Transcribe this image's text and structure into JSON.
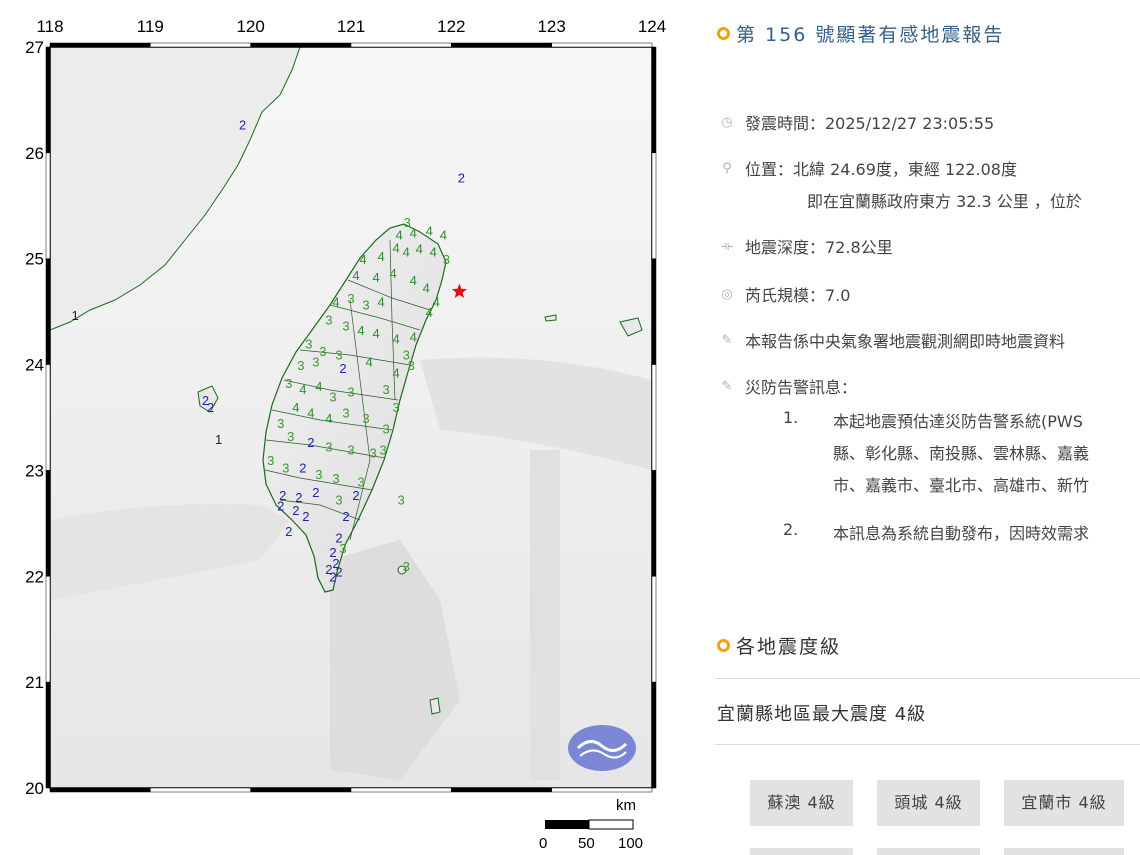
{
  "map": {
    "lon_ticks": [
      "118",
      "119",
      "120",
      "121",
      "122",
      "123",
      "124"
    ],
    "lat_ticks": [
      "27",
      "26",
      "25",
      "24",
      "23",
      "22",
      "21",
      "20"
    ],
    "epicenter_lon": 122.08,
    "epicenter_lat": 24.69,
    "scale": {
      "unit": "km",
      "labels": [
        "0",
        "50",
        "100"
      ]
    },
    "intensity_colors": {
      "4": "#2e8b2e",
      "3": "#3a9a2a",
      "2": "#2222aa",
      "1": "#222222"
    },
    "intensity_labels": [
      {
        "v": "2",
        "lon": 119.92,
        "lat": 26.22
      },
      {
        "v": "2",
        "lon": 122.1,
        "lat": 25.72
      },
      {
        "v": "1",
        "lon": 118.25,
        "lat": 24.42
      },
      {
        "v": "3",
        "lon": 121.56,
        "lat": 25.3
      },
      {
        "v": "4",
        "lon": 121.48,
        "lat": 25.18
      },
      {
        "v": "4",
        "lon": 121.62,
        "lat": 25.2
      },
      {
        "v": "4",
        "lon": 121.78,
        "lat": 25.22
      },
      {
        "v": "4",
        "lon": 121.92,
        "lat": 25.18
      },
      {
        "v": "4",
        "lon": 121.45,
        "lat": 25.06
      },
      {
        "v": "4",
        "lon": 121.55,
        "lat": 25.02
      },
      {
        "v": "4",
        "lon": 121.68,
        "lat": 25.05
      },
      {
        "v": "4",
        "lon": 121.82,
        "lat": 25.02
      },
      {
        "v": "3",
        "lon": 121.95,
        "lat": 24.95
      },
      {
        "v": "4",
        "lon": 121.3,
        "lat": 24.98
      },
      {
        "v": "4",
        "lon": 121.12,
        "lat": 24.95
      },
      {
        "v": "4",
        "lon": 121.05,
        "lat": 24.8
      },
      {
        "v": "4",
        "lon": 121.25,
        "lat": 24.78
      },
      {
        "v": "4",
        "lon": 121.42,
        "lat": 24.82
      },
      {
        "v": "4",
        "lon": 121.62,
        "lat": 24.75
      },
      {
        "v": "4",
        "lon": 121.75,
        "lat": 24.68
      },
      {
        "v": "4",
        "lon": 121.85,
        "lat": 24.55
      },
      {
        "v": "4",
        "lon": 121.78,
        "lat": 24.45
      },
      {
        "v": "3",
        "lon": 121.0,
        "lat": 24.58
      },
      {
        "v": "4",
        "lon": 120.85,
        "lat": 24.55
      },
      {
        "v": "3",
        "lon": 121.15,
        "lat": 24.52
      },
      {
        "v": "4",
        "lon": 121.3,
        "lat": 24.55
      },
      {
        "v": "3",
        "lon": 120.78,
        "lat": 24.38
      },
      {
        "v": "3",
        "lon": 120.95,
        "lat": 24.32
      },
      {
        "v": "4",
        "lon": 121.1,
        "lat": 24.28
      },
      {
        "v": "4",
        "lon": 121.25,
        "lat": 24.25
      },
      {
        "v": "4",
        "lon": 121.45,
        "lat": 24.2
      },
      {
        "v": "4",
        "lon": 121.62,
        "lat": 24.22
      },
      {
        "v": "3",
        "lon": 121.55,
        "lat": 24.05
      },
      {
        "v": "3",
        "lon": 120.58,
        "lat": 24.15
      },
      {
        "v": "3",
        "lon": 120.72,
        "lat": 24.08
      },
      {
        "v": "3",
        "lon": 120.88,
        "lat": 24.05
      },
      {
        "v": "3",
        "lon": 120.65,
        "lat": 23.98
      },
      {
        "v": "3",
        "lon": 120.5,
        "lat": 23.95
      },
      {
        "v": "2",
        "lon": 120.92,
        "lat": 23.92
      },
      {
        "v": "4",
        "lon": 121.18,
        "lat": 23.98
      },
      {
        "v": "4",
        "lon": 121.45,
        "lat": 23.88
      },
      {
        "v": "3",
        "lon": 121.6,
        "lat": 23.95
      },
      {
        "v": "3",
        "lon": 120.38,
        "lat": 23.78
      },
      {
        "v": "4",
        "lon": 120.52,
        "lat": 23.72
      },
      {
        "v": "4",
        "lon": 120.68,
        "lat": 23.75
      },
      {
        "v": "3",
        "lon": 120.82,
        "lat": 23.65
      },
      {
        "v": "3",
        "lon": 121.0,
        "lat": 23.7
      },
      {
        "v": "3",
        "lon": 121.35,
        "lat": 23.72
      },
      {
        "v": "3",
        "lon": 121.45,
        "lat": 23.55
      },
      {
        "v": "4",
        "lon": 120.45,
        "lat": 23.55
      },
      {
        "v": "4",
        "lon": 120.6,
        "lat": 23.5
      },
      {
        "v": "4",
        "lon": 120.78,
        "lat": 23.45
      },
      {
        "v": "3",
        "lon": 120.95,
        "lat": 23.5
      },
      {
        "v": "3",
        "lon": 121.15,
        "lat": 23.45
      },
      {
        "v": "3",
        "lon": 121.35,
        "lat": 23.35
      },
      {
        "v": "3",
        "lon": 120.3,
        "lat": 23.4
      },
      {
        "v": "3",
        "lon": 120.4,
        "lat": 23.28
      },
      {
        "v": "2",
        "lon": 120.6,
        "lat": 23.22
      },
      {
        "v": "3",
        "lon": 120.78,
        "lat": 23.18
      },
      {
        "v": "3",
        "lon": 121.0,
        "lat": 23.15
      },
      {
        "v": "3",
        "lon": 121.22,
        "lat": 23.12
      },
      {
        "v": "3",
        "lon": 121.32,
        "lat": 23.15
      },
      {
        "v": "3",
        "lon": 120.2,
        "lat": 23.05
      },
      {
        "v": "3",
        "lon": 120.35,
        "lat": 22.98
      },
      {
        "v": "2",
        "lon": 120.52,
        "lat": 22.98
      },
      {
        "v": "3",
        "lon": 120.68,
        "lat": 22.92
      },
      {
        "v": "3",
        "lon": 120.85,
        "lat": 22.88
      },
      {
        "v": "3",
        "lon": 121.1,
        "lat": 22.85
      },
      {
        "v": "2",
        "lon": 121.05,
        "lat": 22.72
      },
      {
        "v": "2",
        "lon": 120.32,
        "lat": 22.72
      },
      {
        "v": "2",
        "lon": 120.48,
        "lat": 22.7
      },
      {
        "v": "2",
        "lon": 120.65,
        "lat": 22.75
      },
      {
        "v": "3",
        "lon": 120.88,
        "lat": 22.68
      },
      {
        "v": "2",
        "lon": 120.3,
        "lat": 22.62
      },
      {
        "v": "2",
        "lon": 120.45,
        "lat": 22.58
      },
      {
        "v": "2",
        "lon": 120.55,
        "lat": 22.52
      },
      {
        "v": "2",
        "lon": 120.38,
        "lat": 22.38
      },
      {
        "v": "2",
        "lon": 120.95,
        "lat": 22.52
      },
      {
        "v": "2",
        "lon": 120.88,
        "lat": 22.32
      },
      {
        "v": "2",
        "lon": 120.82,
        "lat": 22.18
      },
      {
        "v": "3",
        "lon": 120.92,
        "lat": 22.22
      },
      {
        "v": "2",
        "lon": 120.85,
        "lat": 22.08
      },
      {
        "v": "2",
        "lon": 120.78,
        "lat": 22.02
      },
      {
        "v": "2",
        "lon": 120.88,
        "lat": 22.0
      },
      {
        "v": "2",
        "lon": 120.82,
        "lat": 21.95
      },
      {
        "v": "3",
        "lon": 121.5,
        "lat": 22.68
      },
      {
        "v": "3",
        "lon": 121.55,
        "lat": 22.05
      },
      {
        "v": "2",
        "lon": 119.55,
        "lat": 23.62
      },
      {
        "v": "2",
        "lon": 119.6,
        "lat": 23.55
      },
      {
        "v": "1",
        "lon": 119.68,
        "lat": 23.25
      }
    ]
  },
  "report": {
    "title": "第 156 號顯著有感地震報告",
    "time_icon": "clock-icon",
    "time": "發震時間：2025/12/27 23:05:55",
    "location": "位置：北緯 24.69度，東經 122.08度",
    "location_cont": "即在宜蘭縣政府東方 32.3 公里 ，位於",
    "depth": "地震深度：72.8公里",
    "magnitude": "芮氏規模：7.0",
    "source_note": "本報告係中央氣象署地震觀測網即時地震資料",
    "warning_title": "災防告警訊息：",
    "warnings": [
      {
        "num": "1.",
        "lines": [
          "本起地震預估達災防告警系統(PWS",
          "縣、彰化縣、南投縣、雲林縣、嘉義",
          "市、嘉義市、臺北市、高雄市、新竹"
        ]
      },
      {
        "num": "2.",
        "lines": [
          "本訊息為系統自動發布，因時效需求"
        ]
      }
    ],
    "section_title": "各地震度級",
    "max_intensity": "宜蘭縣地區最大震度 4級",
    "stations": [
      "蘇澳 4級",
      "頭城 4級",
      "宜蘭市 4級"
    ]
  }
}
